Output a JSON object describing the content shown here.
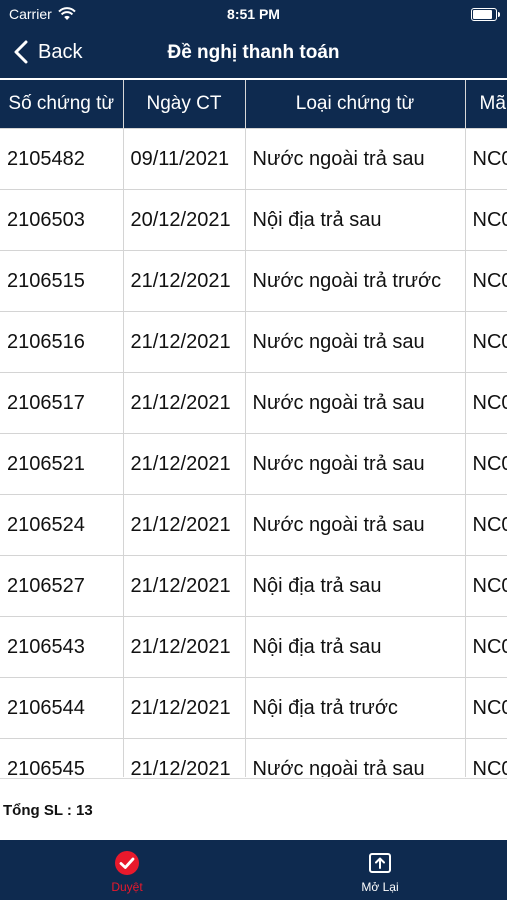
{
  "status_bar": {
    "carrier": "Carrier",
    "time": "8:51 PM"
  },
  "nav": {
    "back_label": "Back",
    "title": "Đề nghị thanh toán"
  },
  "table": {
    "headers": [
      "Số chứng từ",
      "Ngày CT",
      "Loại chứng từ",
      "Mã"
    ],
    "rows": [
      [
        "2105482",
        "09/11/2021",
        "Nước ngoài trả sau",
        "NC0"
      ],
      [
        "2106503",
        "20/12/2021",
        "Nội địa trả sau",
        "NC0"
      ],
      [
        "2106515",
        "21/12/2021",
        "Nước ngoài trả trước",
        "NC0"
      ],
      [
        "2106516",
        "21/12/2021",
        "Nước ngoài trả sau",
        "NC0"
      ],
      [
        "2106517",
        "21/12/2021",
        "Nước ngoài trả sau",
        "NC0"
      ],
      [
        "2106521",
        "21/12/2021",
        "Nước ngoài trả sau",
        "NC0"
      ],
      [
        "2106524",
        "21/12/2021",
        "Nước ngoài trả sau",
        "NC0"
      ],
      [
        "2106527",
        "21/12/2021",
        "Nội địa trả sau",
        "NC0"
      ],
      [
        "2106543",
        "21/12/2021",
        "Nội địa trả sau",
        "NC0"
      ],
      [
        "2106544",
        "21/12/2021",
        "Nội địa trả trước",
        "NC0"
      ],
      [
        "2106545",
        "21/12/2021",
        "Nước ngoài trả sau",
        "NC0"
      ]
    ]
  },
  "summary": {
    "total_label": "Tổng SL : 13"
  },
  "tabbar": {
    "approve": {
      "label": "Duyệt",
      "icon": "check-circle-icon",
      "color": "#e8192c"
    },
    "reopen": {
      "label": "Mở Lại",
      "icon": "reopen-box-icon",
      "color": "#ffffff"
    }
  },
  "colors": {
    "header_bg": "#0e2a4f",
    "grid": "#d4d4d4"
  }
}
